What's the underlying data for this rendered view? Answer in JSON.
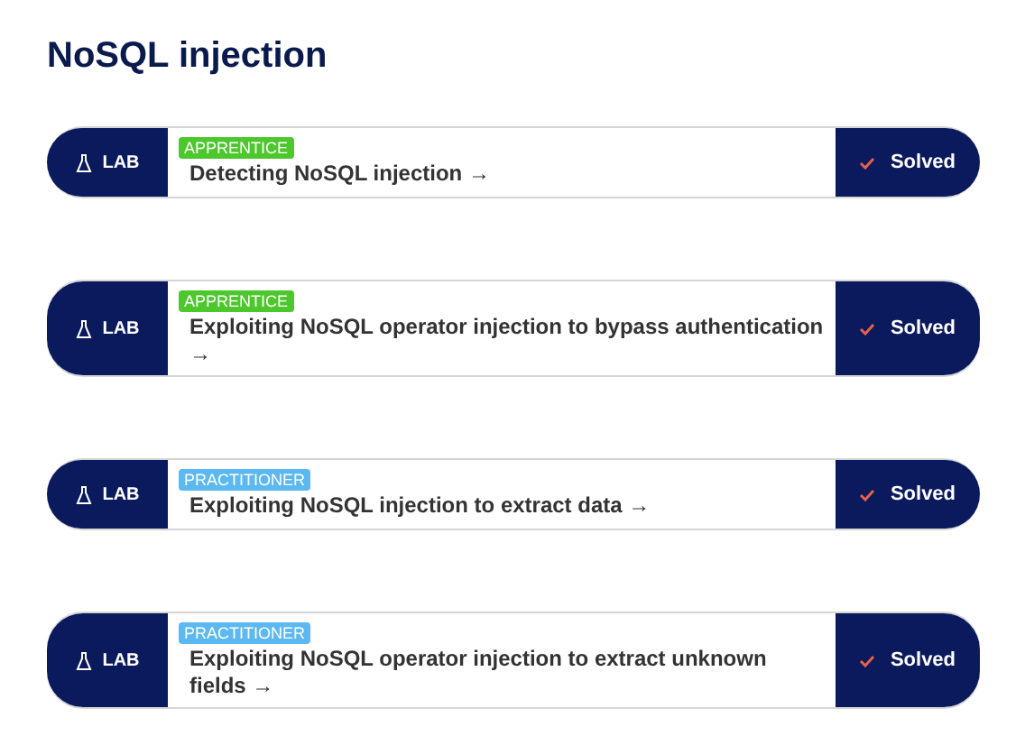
{
  "heading": "NoSQL injection",
  "labs": [
    {
      "tag": "LAB",
      "difficulty": "APPRENTICE",
      "color": "#4cc72c",
      "title": "Detecting NoSQL injection →",
      "status": "Solved",
      "solved": true
    },
    {
      "tag": "LAB",
      "difficulty": "APPRENTICE",
      "color": "#4cc72c",
      "title": "Exploiting NoSQL operator injection to bypass authentication →",
      "status": "Solved",
      "solved": true
    },
    {
      "tag": "LAB",
      "difficulty": "PRACTITIONER",
      "color": "#5bb8f0",
      "title": "Exploiting NoSQL injection to extract data →",
      "status": "Solved",
      "solved": true
    },
    {
      "tag": "LAB",
      "difficulty": "PRACTITIONER",
      "color": "#5bb8f0",
      "title": "Exploiting NoSQL operator injection to extract unknown fields →",
      "status": "Solved",
      "solved": true
    }
  ]
}
